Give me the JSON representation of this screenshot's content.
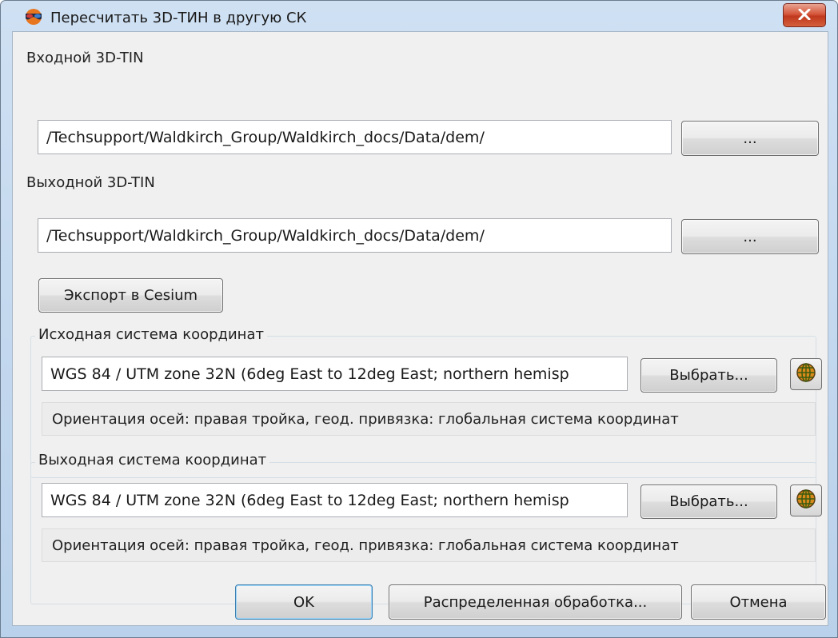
{
  "window": {
    "title": "Пересчитать 3D-ТИН в другую СК",
    "icon": "app-3d-glasses-icon",
    "close_icon": "close-icon"
  },
  "input_tin": {
    "label": "Входной 3D-TIN",
    "value": "/Techsupport/Waldkirch_Group/Waldkirch_docs/Data/dem/",
    "browse_label": "..."
  },
  "output_tin": {
    "label": "Выходной 3D-TIN",
    "value": "/Techsupport/Waldkirch_Group/Waldkirch_docs/Data/dem/",
    "browse_label": "..."
  },
  "export_cesium_label": "Экспорт в Cesium",
  "source_cs": {
    "legend": "Исходная система координат",
    "value": "WGS 84 / UTM zone 32N (6deg East to 12deg East; northern hemisp",
    "select_label": "Выбрать...",
    "globe_icon": "globe-icon",
    "info": "Ориентация осей: правая тройка, геод. привязка: глобальная система координат"
  },
  "target_cs": {
    "legend": "Выходная система координат",
    "value": "WGS 84 / UTM zone 32N (6deg East to 12deg East; northern hemisp",
    "select_label": "Выбрать...",
    "globe_icon": "globe-icon",
    "info": "Ориентация осей: правая тройка, геод. привязка: глобальная система координат"
  },
  "buttons": {
    "ok": "OK",
    "distributed": "Распределенная обработка...",
    "cancel": "Отмена"
  },
  "colors": {
    "close_button": "#c7432a",
    "default_button_border": "#3c7fb1",
    "dialog_background": "#f0f0f0"
  }
}
